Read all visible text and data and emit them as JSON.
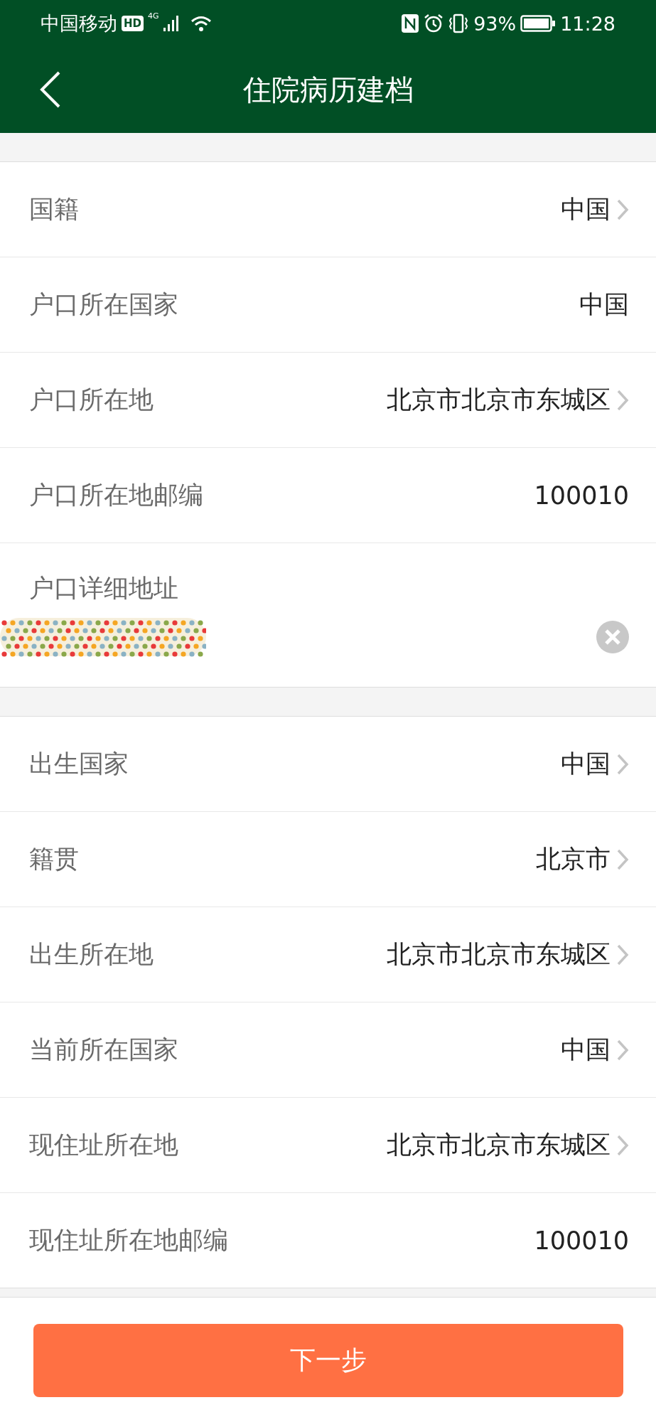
{
  "status_bar": {
    "carrier": "中国移动",
    "hd": "HD",
    "network": "4G",
    "battery_text": "93%",
    "time": "11:28"
  },
  "header": {
    "title": "住院病历建档"
  },
  "sections": [
    {
      "rows": [
        {
          "kind": "select",
          "label": "国籍",
          "value": "中国"
        },
        {
          "kind": "text",
          "label": "户口所在国家",
          "value": "中国"
        },
        {
          "kind": "select",
          "label": "户口所在地",
          "value": "北京市北京市东城区"
        },
        {
          "kind": "text",
          "label": "户口所在地邮编",
          "value": "100010"
        },
        {
          "kind": "address",
          "label": "户口详细地址"
        }
      ]
    },
    {
      "rows": [
        {
          "kind": "select",
          "label": "出生国家",
          "value": "中国"
        },
        {
          "kind": "select",
          "label": "籍贯",
          "value": "北京市"
        },
        {
          "kind": "select",
          "label": "出生所在地",
          "value": "北京市北京市东城区"
        },
        {
          "kind": "select",
          "label": "当前所在国家",
          "value": "中国"
        },
        {
          "kind": "select",
          "label": "现住址所在地",
          "value": "北京市北京市东城区"
        },
        {
          "kind": "text",
          "label": "现住址所在地邮编",
          "value": "100010"
        }
      ]
    }
  ],
  "next_button": "下一步"
}
